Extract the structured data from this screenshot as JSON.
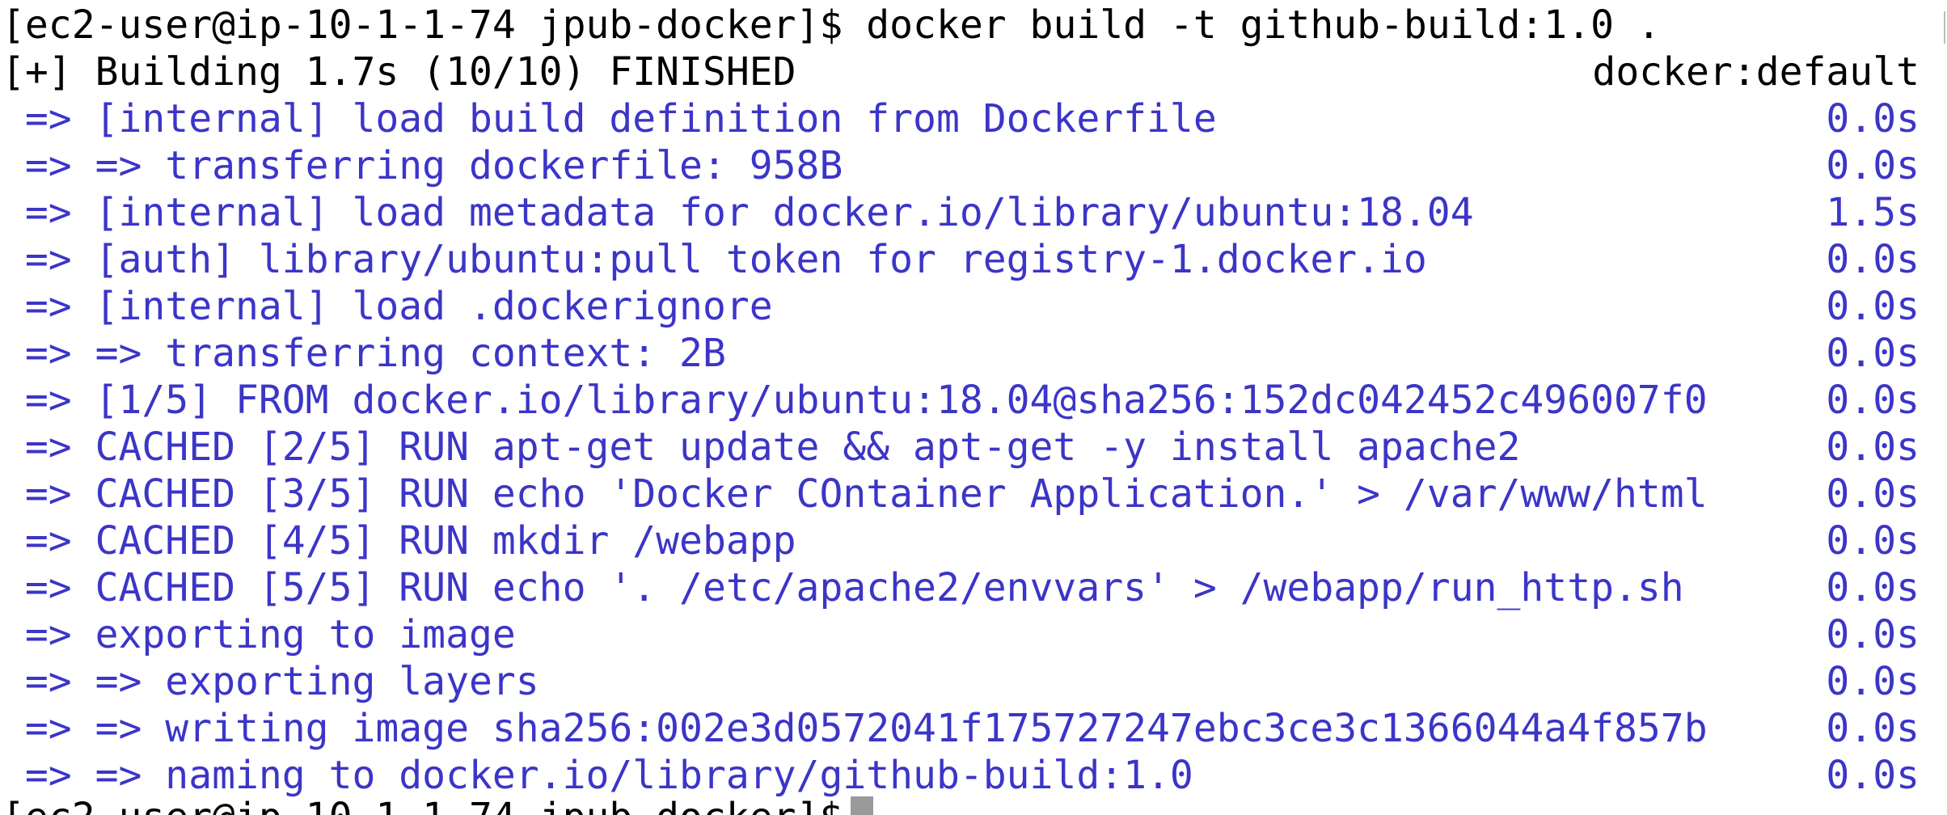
{
  "prompt": {
    "host": "[ec2-user@ip-10-1-1-74 jpub-docker]$",
    "command": "docker build -t github-build:1.0 ."
  },
  "status": {
    "summary": "[+] Building 1.7s (10/10) FINISHED",
    "context": "docker:default"
  },
  "steps": [
    {
      "text": " => [internal] load build definition from Dockerfile",
      "time": "0.0s"
    },
    {
      "text": " => => transferring dockerfile: 958B",
      "time": "0.0s"
    },
    {
      "text": " => [internal] load metadata for docker.io/library/ubuntu:18.04",
      "time": "1.5s"
    },
    {
      "text": " => [auth] library/ubuntu:pull token for registry-1.docker.io",
      "time": "0.0s"
    },
    {
      "text": " => [internal] load .dockerignore",
      "time": "0.0s"
    },
    {
      "text": " => => transferring context: 2B",
      "time": "0.0s"
    },
    {
      "text": " => [1/5] FROM docker.io/library/ubuntu:18.04@sha256:152dc042452c496007f0",
      "time": "0.0s"
    },
    {
      "text": " => CACHED [2/5] RUN apt-get update && apt-get -y install apache2",
      "time": "0.0s"
    },
    {
      "text": " => CACHED [3/5] RUN echo 'Docker COntainer Application.' > /var/www/html",
      "time": "0.0s"
    },
    {
      "text": " => CACHED [4/5] RUN mkdir /webapp",
      "time": "0.0s"
    },
    {
      "text": " => CACHED [5/5] RUN echo '. /etc/apache2/envvars' > /webapp/run_http.sh",
      "time": "0.0s"
    },
    {
      "text": " => exporting to image",
      "time": "0.0s"
    },
    {
      "text": " => => exporting layers",
      "time": "0.0s"
    },
    {
      "text": " => => writing image sha256:002e3d0572041f175727247ebc3ce3c1366044a4f857b",
      "time": "0.0s"
    },
    {
      "text": " => => naming to docker.io/library/github-build:1.0",
      "time": "0.0s"
    }
  ],
  "next_prompt": "[ec2-user@ip-10-1-1-74 jpub-docker]$",
  "colors": {
    "background": "#ffffff",
    "text": "#000000",
    "step_text": "#3b35c8",
    "cursor": "#9a9a9a"
  }
}
